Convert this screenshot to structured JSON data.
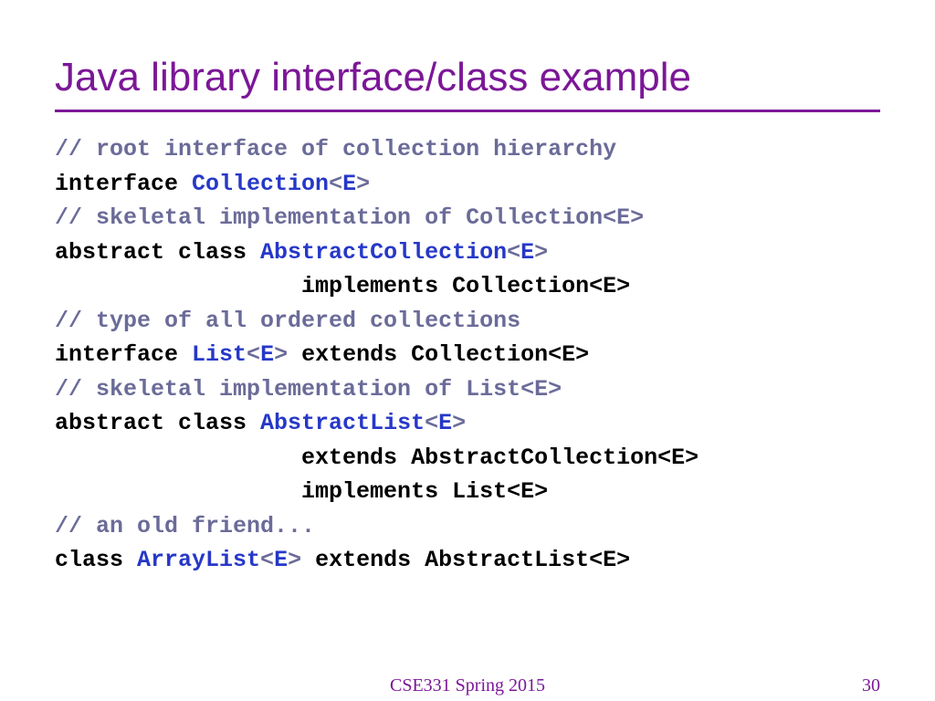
{
  "title": "Java library interface/class example",
  "lines": [
    {
      "t": "comment",
      "text": "// root interface of collection hierarchy"
    },
    {
      "t": "decl",
      "prefix": "interface ",
      "type": "Collection",
      "gen": "E",
      "suffix": ""
    },
    {
      "t": "comment",
      "text": "// skeletal implementation of Collection<E>"
    },
    {
      "t": "decl",
      "prefix": "abstract class ",
      "type": "AbstractCollection",
      "gen": "E",
      "suffix": ""
    },
    {
      "t": "plain",
      "text": "                  implements Collection<E>"
    },
    {
      "t": "comment",
      "text": "// type of all ordered collections"
    },
    {
      "t": "decl",
      "prefix": "interface ",
      "type": "List",
      "gen": "E",
      "suffix": " extends Collection<E>"
    },
    {
      "t": "comment",
      "text": "// skeletal implementation of List<E>"
    },
    {
      "t": "decl",
      "prefix": "abstract class ",
      "type": "AbstractList",
      "gen": "E",
      "suffix": ""
    },
    {
      "t": "plain",
      "text": "                  extends AbstractCollection<E>"
    },
    {
      "t": "plain",
      "text": "                  implements List<E>"
    },
    {
      "t": "comment",
      "text": "// an old friend..."
    },
    {
      "t": "decl",
      "prefix": "class ",
      "type": "ArrayList",
      "gen": "E",
      "suffix": " extends AbstractList<E>"
    }
  ],
  "footer": {
    "course": "CSE331 Spring 2015",
    "page": "30"
  }
}
